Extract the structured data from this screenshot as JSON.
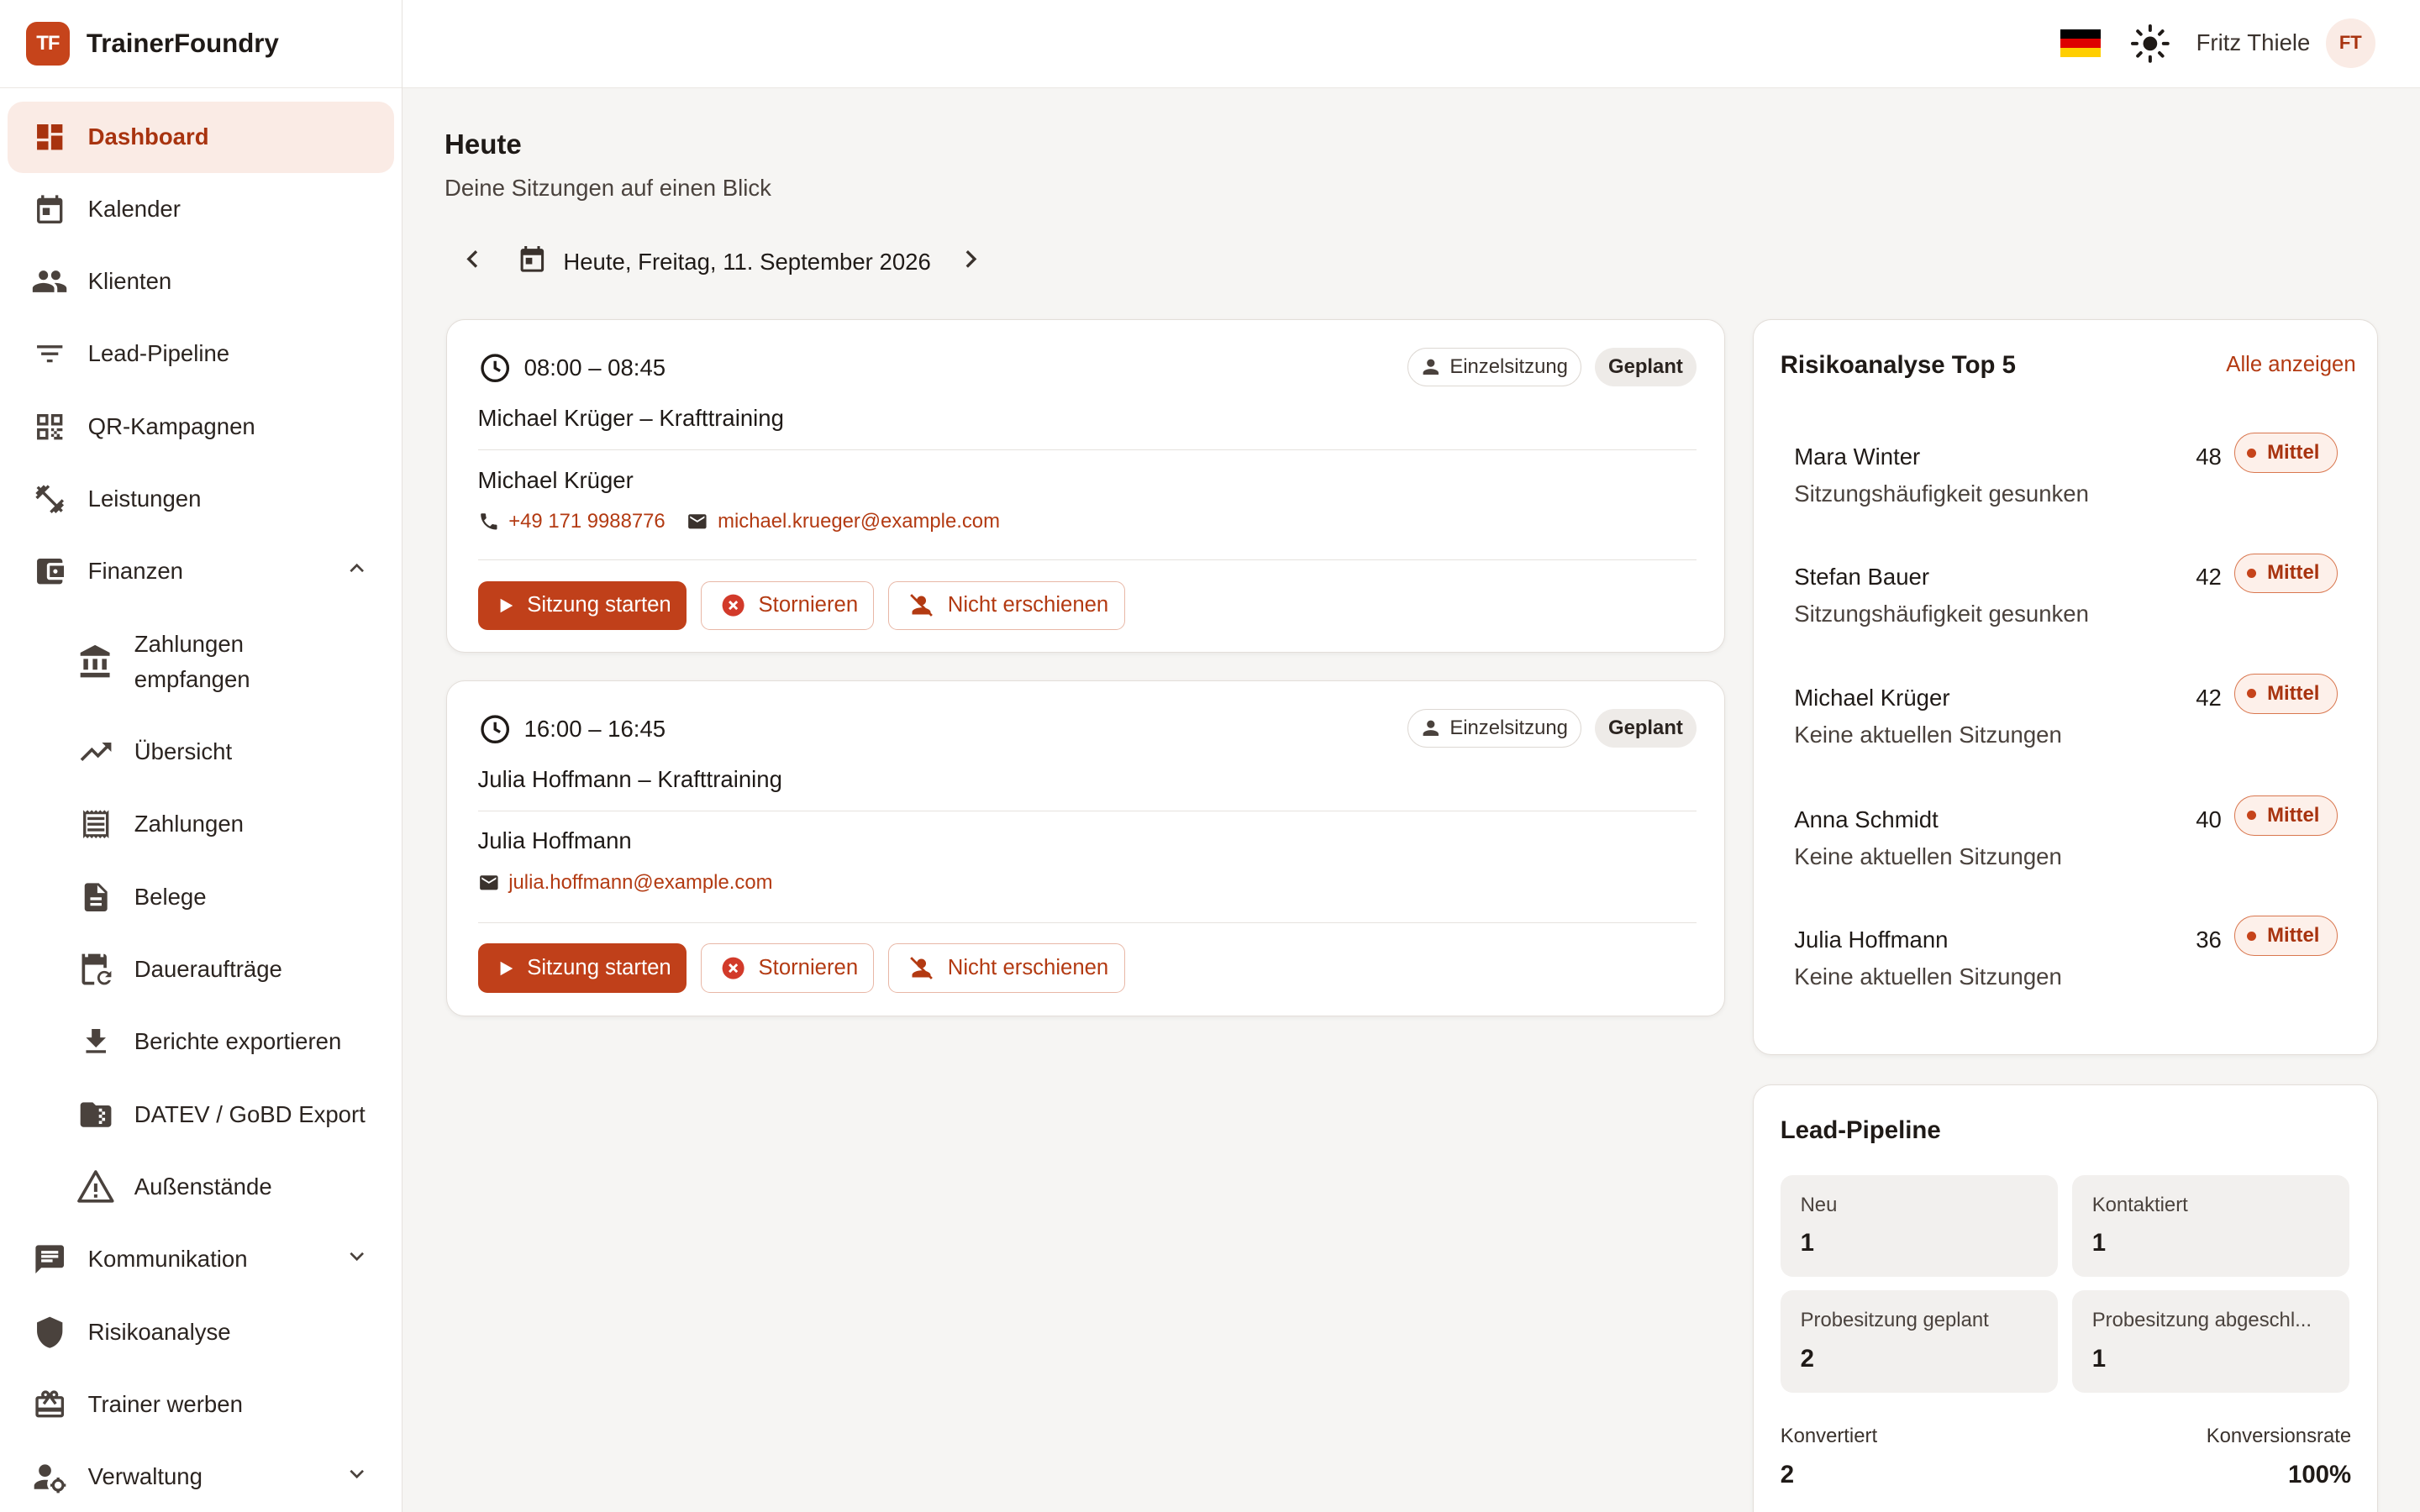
{
  "brand": {
    "logo": "TF",
    "name": "TrainerFoundry"
  },
  "header": {
    "language_flag": "flag-germany",
    "user_name": "Fritz Thiele",
    "avatar_initials": "FT"
  },
  "colors": {
    "accent": "#c0401a",
    "accent_light": "#faebe5",
    "background": "#f6f5f3"
  },
  "sidebar": {
    "items": [
      {
        "label": "Dashboard",
        "icon": "dashboard-icon",
        "active": true
      },
      {
        "label": "Kalender",
        "icon": "calendar-icon"
      },
      {
        "label": "Klienten",
        "icon": "people-icon"
      },
      {
        "label": "Lead-Pipeline",
        "icon": "filter-icon"
      },
      {
        "label": "QR-Kampagnen",
        "icon": "qr-code-icon"
      },
      {
        "label": "Leistungen",
        "icon": "fitness-icon"
      },
      {
        "label": "Finanzen",
        "icon": "wallet-icon",
        "expanded": true
      }
    ],
    "finance_sub": [
      {
        "label": "Zahlungen empfangen",
        "icon": "bank-icon"
      },
      {
        "label": "Übersicht",
        "icon": "trending-up-icon"
      },
      {
        "label": "Zahlungen",
        "icon": "receipt-icon"
      },
      {
        "label": "Belege",
        "icon": "document-icon"
      },
      {
        "label": "Daueraufträge",
        "icon": "calendar-repeat-icon"
      },
      {
        "label": "Berichte exportieren",
        "icon": "download-icon"
      },
      {
        "label": "DATEV / GoBD Export",
        "icon": "folder-zip-icon"
      },
      {
        "label": "Außenstände",
        "icon": "warning-icon"
      }
    ],
    "bottom_items": [
      {
        "label": "Kommunikation",
        "icon": "chat-icon",
        "expandable": true
      },
      {
        "label": "Risikoanalyse",
        "icon": "shield-icon"
      },
      {
        "label": "Trainer werben",
        "icon": "gift-icon"
      },
      {
        "label": "Verwaltung",
        "icon": "admin-icon",
        "expandable": true
      }
    ]
  },
  "main": {
    "title": "Heute",
    "subtitle": "Deine Sitzungen auf einen Blick",
    "date_label": "Heute, Freitag, 11. September 2026",
    "sessions": [
      {
        "time": "08:00 – 08:45",
        "type": "Einzelsitzung",
        "status": "Geplant",
        "title": "Michael Krüger – Krafttraining",
        "client": "Michael Krüger",
        "phone": "+49 171 9988776",
        "email": "michael.krueger@example.com",
        "actions": {
          "start": "Sitzung starten",
          "cancel": "Stornieren",
          "noshow": "Nicht erschienen"
        }
      },
      {
        "time": "16:00 – 16:45",
        "type": "Einzelsitzung",
        "status": "Geplant",
        "title": "Julia Hoffmann – Krafttraining",
        "client": "Julia Hoffmann",
        "phone": "",
        "email": "julia.hoffmann@example.com",
        "actions": {
          "start": "Sitzung starten",
          "cancel": "Stornieren",
          "noshow": "Nicht erschienen"
        }
      }
    ]
  },
  "risk": {
    "title": "Risikoanalyse Top 5",
    "show_all": "Alle anzeigen",
    "rows": [
      {
        "name": "Mara Winter",
        "reason": "Sitzungshäufigkeit gesunken",
        "score": "48",
        "level": "Mittel"
      },
      {
        "name": "Stefan Bauer",
        "reason": "Sitzungshäufigkeit gesunken",
        "score": "42",
        "level": "Mittel"
      },
      {
        "name": "Michael Krüger",
        "reason": "Keine aktuellen Sitzungen",
        "score": "42",
        "level": "Mittel"
      },
      {
        "name": "Anna Schmidt",
        "reason": "Keine aktuellen Sitzungen",
        "score": "40",
        "level": "Mittel"
      },
      {
        "name": "Julia Hoffmann",
        "reason": "Keine aktuellen Sitzungen",
        "score": "36",
        "level": "Mittel"
      }
    ]
  },
  "lead": {
    "title": "Lead-Pipeline",
    "tiles": [
      {
        "label": "Neu",
        "value": "1"
      },
      {
        "label": "Kontaktiert",
        "value": "1"
      },
      {
        "label": "Probesitzung geplant",
        "value": "2"
      },
      {
        "label": "Probesitzung abgeschl...",
        "value": "1"
      }
    ],
    "converted_label": "Konvertiert",
    "converted_value": "2",
    "rate_label": "Konversionsrate",
    "rate_value": "100%"
  }
}
